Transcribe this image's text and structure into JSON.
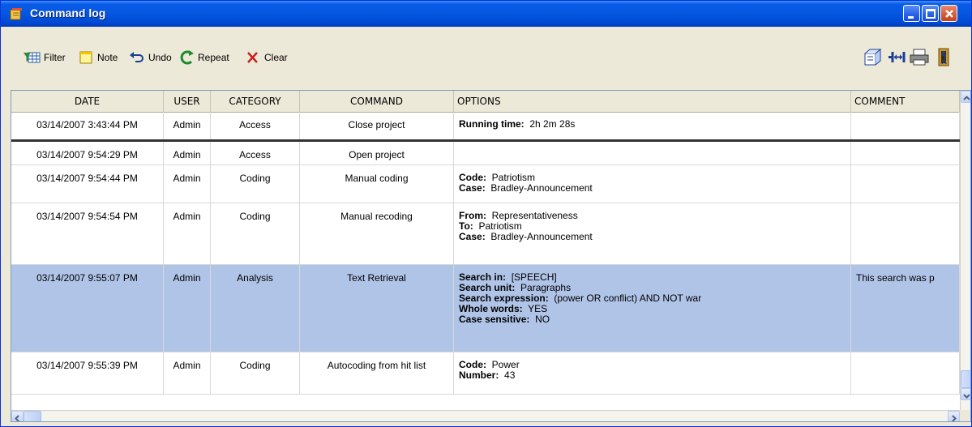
{
  "window": {
    "title": "Command log",
    "accent": "#0a5ce8"
  },
  "toolbar": {
    "filter_label": "Filter",
    "note_label": "Note",
    "undo_label": "Undo",
    "repeat_label": "Repeat",
    "clear_label": "Clear",
    "right_icons": [
      "export-icon",
      "column-width-icon",
      "print-icon",
      "exit-icon"
    ]
  },
  "table": {
    "columns": [
      "DATE",
      "USER",
      "CATEGORY",
      "COMMAND",
      "OPTIONS",
      "COMMENT"
    ],
    "rows": [
      {
        "date": "03/14/2007 3:43:44 PM",
        "user": "Admin",
        "category": "Access",
        "command": "Close project",
        "options": [
          {
            "key": "Running time:",
            "value": "2h 2m 28s"
          }
        ],
        "comment": ""
      },
      {
        "date": "03/14/2007 9:54:29 PM",
        "user": "Admin",
        "category": "Access",
        "command": "Open project",
        "options": [],
        "comment": ""
      },
      {
        "date": "03/14/2007 9:54:44 PM",
        "user": "Admin",
        "category": "Coding",
        "command": "Manual coding",
        "options": [
          {
            "key": "Code:",
            "value": "Patriotism"
          },
          {
            "key": "Case:",
            "value": "Bradley-Announcement"
          }
        ],
        "comment": ""
      },
      {
        "date": "03/14/2007 9:54:54 PM",
        "user": "Admin",
        "category": "Coding",
        "command": "Manual recoding",
        "options": [
          {
            "key": "From:",
            "value": "Representativeness"
          },
          {
            "key": "To:",
            "value": "Patriotism"
          },
          {
            "key": "Case:",
            "value": "Bradley-Announcement"
          }
        ],
        "comment": ""
      },
      {
        "date": "03/14/2007 9:55:07 PM",
        "user": "Admin",
        "category": "Analysis",
        "command": "Text Retrieval",
        "options": [
          {
            "key": "Search in:",
            "value": "[SPEECH]"
          },
          {
            "key": "Search unit:",
            "value": "Paragraphs"
          },
          {
            "key": "Search expression:",
            "value": "(power OR conflict) AND NOT war"
          },
          {
            "key": "Whole words:",
            "value": "YES"
          },
          {
            "key": "Case sensitive:",
            "value": "NO"
          }
        ],
        "comment": "This search was p",
        "selected": true
      },
      {
        "date": "03/14/2007 9:55:39 PM",
        "user": "Admin",
        "category": "Coding",
        "command": "Autocoding from hit list",
        "options": [
          {
            "key": "Code:",
            "value": "Power"
          },
          {
            "key": "Number:",
            "value": "43"
          }
        ],
        "comment": ""
      }
    ],
    "selected_color": "#b0c4e8"
  }
}
